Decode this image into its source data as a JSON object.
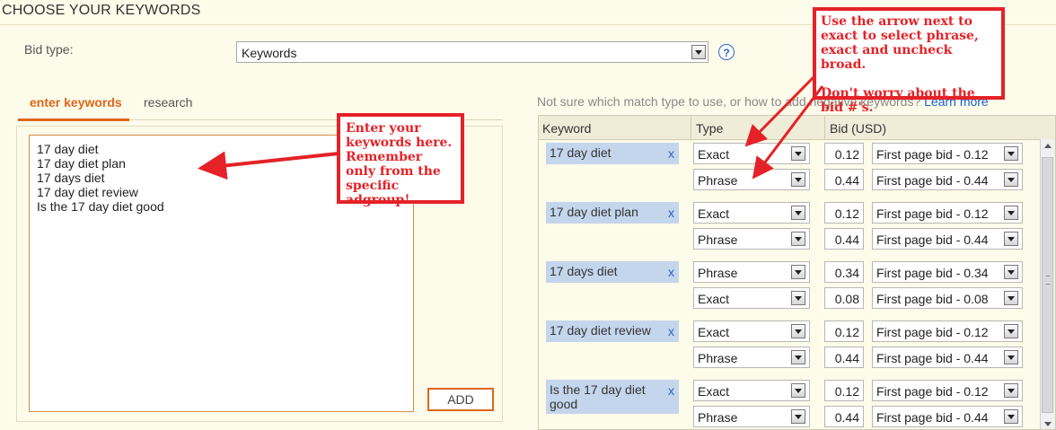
{
  "page": {
    "title": "CHOOSE YOUR KEYWORDS"
  },
  "bid_type": {
    "label": "Bid type:",
    "value": "Keywords",
    "help_icon": "question-icon"
  },
  "tabs": [
    {
      "label": "enter keywords",
      "active": true
    },
    {
      "label": "research",
      "active": false
    }
  ],
  "textarea": {
    "lines": [
      "17 day diet",
      "17 day diet plan",
      "17 days diet",
      "17 day diet review",
      "Is the 17 day diet good"
    ]
  },
  "add_button": {
    "label": "ADD"
  },
  "help_text": {
    "before_link": "Not sure which match type to use, or how to add negative keywords?",
    "link": "Learn more"
  },
  "table": {
    "headers": {
      "keyword": "Keyword",
      "type": "Type",
      "bid": "Bid (USD)"
    },
    "remove_label": "x",
    "groups": [
      {
        "keyword": "17 day diet",
        "rows": [
          {
            "type": "Exact",
            "bid": "0.12",
            "suggestion": "First page bid - 0.12"
          },
          {
            "type": "Phrase",
            "bid": "0.44",
            "suggestion": "First page bid - 0.44"
          }
        ]
      },
      {
        "keyword": "17 day diet plan",
        "rows": [
          {
            "type": "Exact",
            "bid": "0.12",
            "suggestion": "First page bid - 0.12"
          },
          {
            "type": "Phrase",
            "bid": "0.44",
            "suggestion": "First page bid - 0.44"
          }
        ]
      },
      {
        "keyword": "17 days diet",
        "rows": [
          {
            "type": "Phrase",
            "bid": "0.34",
            "suggestion": "First page bid - 0.34"
          },
          {
            "type": "Exact",
            "bid": "0.08",
            "suggestion": "First page bid - 0.08"
          }
        ]
      },
      {
        "keyword": "17 day diet review",
        "rows": [
          {
            "type": "Exact",
            "bid": "0.12",
            "suggestion": "First page bid - 0.12"
          },
          {
            "type": "Phrase",
            "bid": "0.44",
            "suggestion": "First page bid - 0.44"
          }
        ]
      },
      {
        "keyword": "Is the 17 day diet good",
        "rows": [
          {
            "type": "Exact",
            "bid": "0.12",
            "suggestion": "First page bid - 0.12"
          },
          {
            "type": "Phrase",
            "bid": "0.44",
            "suggestion": "First page bid - 0.44"
          }
        ]
      }
    ]
  },
  "annotations": {
    "enter": {
      "text": "Enter your keywords here. Remember only from the specific adgroup!"
    },
    "arrow_note": {
      "line1": "Use the arrow next to exact to select phrase, exact and uncheck broad.",
      "line2": "Don't worry about the bid #'s."
    },
    "color": "#e42227"
  }
}
